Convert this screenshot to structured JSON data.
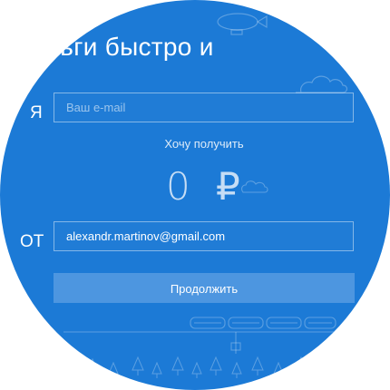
{
  "headline": "ить деньги быстро и",
  "form": {
    "name_label": "Я",
    "email_placeholder": "Ваш e-mail",
    "want_label": "Хочу получить",
    "amount": "0",
    "currency_symbol": "₽",
    "from_label": "ОТ",
    "from_email": "alexandr.martinov@gmail.com",
    "continue_label": "Продолжить"
  },
  "colors": {
    "background": "#1c7ad6",
    "button": "#4d96e0",
    "text": "#ffffff"
  },
  "icons": [
    "airship-icon",
    "cloud-icon",
    "train-icon",
    "tree-icon"
  ]
}
